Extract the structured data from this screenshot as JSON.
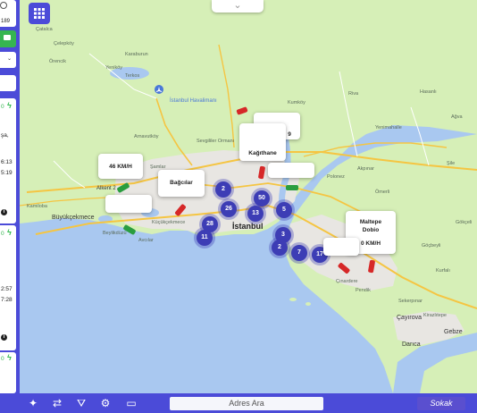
{
  "sidebar": {
    "top_counter": "189",
    "cards": [
      {
        "line1": "0",
        "line2": "şa,",
        "time1": "6:13",
        "time2": "5:19"
      },
      {
        "line1": "0",
        "time1": "2:57",
        "time2": "7:28"
      },
      {
        "line1": "0"
      }
    ],
    "info_glyph": "i"
  },
  "header": {
    "chevron_icon": "chevron-down-icon"
  },
  "popups": [
    {
      "text": "46 KM/H"
    },
    {
      "text": "Bağcılar"
    },
    {
      "text": "Kağıthane"
    },
    {
      "text": "9"
    },
    {
      "title": "Maltepe Dobio",
      "speed": "0 KM/H"
    }
  ],
  "clusters": [
    "2",
    "26",
    "28",
    "11",
    "50",
    "13",
    "5",
    "3",
    "2",
    "7",
    "17"
  ],
  "places": {
    "city": "İstanbul",
    "airport": "İstanbul Havalimanı",
    "bold": [
      "Büyükçekmece",
      "Alkent 2"
    ],
    "small": [
      "Çatalca",
      "Çelepköy",
      "Örencik",
      "Karaburun",
      "Yeniköy",
      "Terkos",
      "Arnavutköy",
      "Sevgililer Ormanı",
      "Kumköy",
      "Riva",
      "Şamlar",
      "Kamiloba",
      "Küçükçekmece",
      "Avcılar",
      "Beylikdüzü",
      "Polonez",
      "Ömerli",
      "Şile",
      "Ağva",
      "Gebze",
      "Darıca",
      "Çayırova",
      "Pendik",
      "Çınardere",
      "Göçbeyli",
      "Sekerpınar",
      "Kirazlıtepe",
      "Yenimahalle",
      "Hasanlı",
      "Kurfalı",
      "Akpınar",
      "Gökçeli"
    ]
  },
  "bottom_bar": {
    "search_placeholder": "Adres Ara",
    "map_mode": "Sokak",
    "icons": [
      "magic-wand-icon",
      "shuffle-icon",
      "road-icon",
      "gear-cluster-icon",
      "monitor-icon"
    ]
  },
  "colors": {
    "land": "#d6efb7",
    "sea": "#a9c8f0",
    "urban": "#e8e6e2",
    "accent": "#4b4bd8",
    "cluster": "#3d3db5",
    "road_major": "#f5c542",
    "vehicle_red": "#d62828",
    "vehicle_green": "#2a9d3f"
  }
}
